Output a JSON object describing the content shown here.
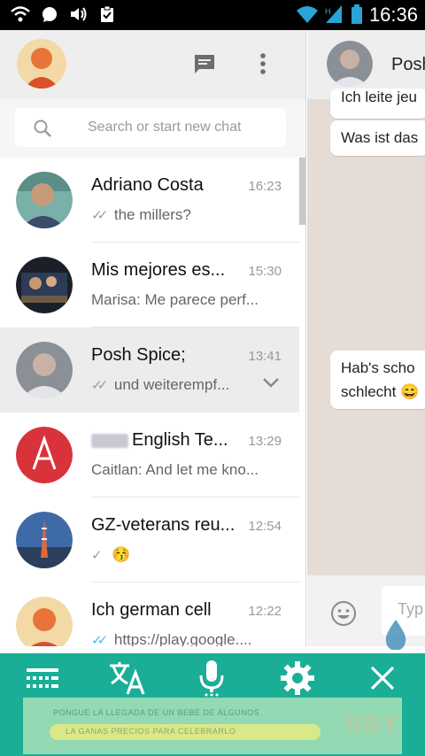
{
  "status_bar": {
    "time": "16:36"
  },
  "left_pane": {
    "search": {
      "placeholder": "Search or start new chat"
    },
    "chats": [
      {
        "name": "Adriano Costa",
        "time": "16:23",
        "preview": "the millers?",
        "ticks": "double-grey"
      },
      {
        "name": "Mis mejores es...",
        "time": "15:30",
        "preview": "Marisa: Me parece perf...",
        "ticks": "none"
      },
      {
        "name": "Posh Spice;",
        "time": "13:41",
        "preview": "und weiterempf...",
        "ticks": "double-grey"
      },
      {
        "name": "English Te...",
        "name_prefix_blurred": "NLA",
        "time": "13:29",
        "preview": "Caitlan: And let me kno...",
        "ticks": "none"
      },
      {
        "name": "GZ-veterans reu...",
        "time": "12:54",
        "preview": "😚",
        "ticks": "single-grey"
      },
      {
        "name": "Ich german cell",
        "time": "12:22",
        "preview": "https://play.google....",
        "ticks": "double-blue"
      }
    ]
  },
  "right_pane": {
    "title": "Posh",
    "messages": [
      {
        "text": "Ich leite jeu"
      },
      {
        "text": "Was ist das"
      },
      {
        "text": "Hab's scho"
      },
      {
        "text": "schlecht 😄"
      }
    ],
    "composer_placeholder": "Typ"
  },
  "toolbar": {
    "buttons": [
      "keyboard-icon",
      "translate-icon",
      "microphone-icon",
      "gear-icon",
      "close-icon"
    ]
  },
  "ad": {
    "line1": "PONGUE LA LLEGADA DE UN BEBÉ DE ALGUNOS",
    "line2": "LA GANAS PRECIOS PARA CELEBRARLO",
    "logo": "BBY"
  },
  "colors": {
    "toolbar": "#1aae96",
    "chat_background": "#e5ddd5",
    "header_background": "#eeeeee",
    "blue_ticks": "#4fb6ec"
  }
}
